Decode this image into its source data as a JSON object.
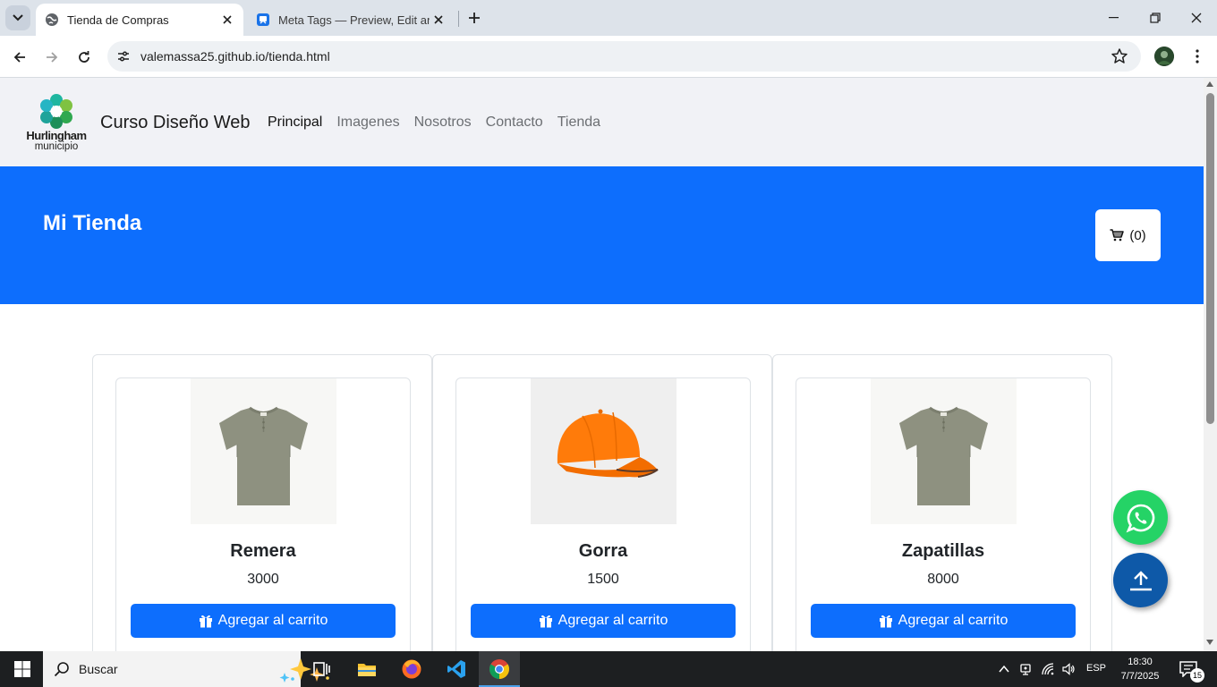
{
  "browser": {
    "tabs": [
      {
        "title": "Tienda de Compras",
        "active": true
      },
      {
        "title": "Meta Tags — Preview, Edit and Generate",
        "active": false
      }
    ],
    "url": "valemassa25.github.io/tienda.html"
  },
  "site": {
    "logo": {
      "line1": "Hurlingham",
      "line2": "municipio"
    },
    "brand": "Curso Diseño Web",
    "nav": [
      {
        "label": "Principal",
        "active": true
      },
      {
        "label": "Imagenes",
        "active": false
      },
      {
        "label": "Nosotros",
        "active": false
      },
      {
        "label": "Contacto",
        "active": false
      },
      {
        "label": "Tienda",
        "active": false
      }
    ],
    "hero_title": "Mi Tienda",
    "cart_label": "(0)",
    "products": [
      {
        "name": "Remera",
        "price": "3000",
        "button": "Agregar al carrito",
        "image": "green-tshirt"
      },
      {
        "name": "Gorra",
        "price": "1500",
        "button": "Agregar al carrito",
        "image": "orange-cap"
      },
      {
        "name": "Zapatillas",
        "price": "8000",
        "button": "Agregar al carrito",
        "image": "green-tshirt"
      }
    ]
  },
  "taskbar": {
    "search_placeholder": "Buscar",
    "language": "ESP",
    "time": "18:30",
    "date": "7/7/2025",
    "notifications": "15"
  },
  "colors": {
    "primary": "#0d6efd",
    "whatsapp": "#25d366",
    "scroll_top": "#0e59a8",
    "nav_bg": "#f1f2f6"
  }
}
